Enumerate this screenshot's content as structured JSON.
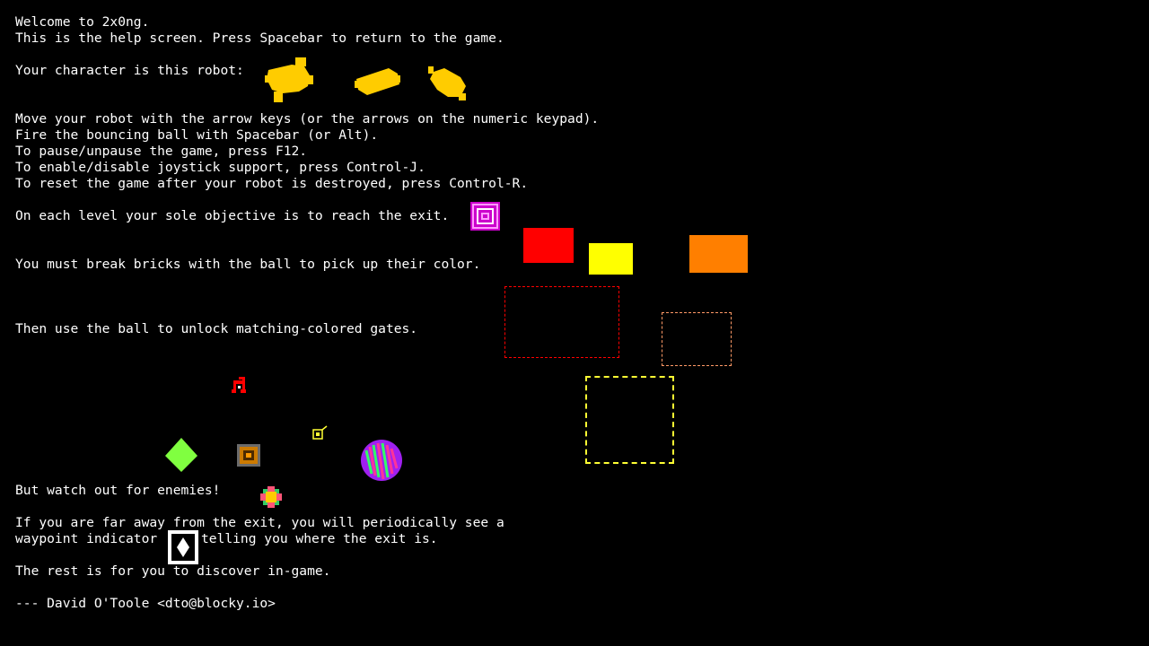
{
  "help": {
    "welcome": "Welcome to 2x0ng.",
    "help_screen": "This is the help screen. Press Spacebar to return to the game.",
    "character": "Your character is this robot:",
    "move": "Move your robot with the arrow keys (or the arrows on the numeric keypad).",
    "fire": "Fire the bouncing ball with Spacebar (or Alt).",
    "pause": "To pause/unpause the game, press F12.",
    "joystick": "To enable/disable joystick support, press Control-J.",
    "reset": "To reset the game after your robot is destroyed, press Control-R.",
    "objective": "On each level your sole objective is to reach the exit.",
    "bricks": "You must break bricks with the ball to pick up their color.",
    "gates": "Then use the ball to unlock matching-colored gates.",
    "enemies": "But watch out for enemies!",
    "waypoint_1": "If you are far away from the exit, you will periodically see a",
    "waypoint_2a": "waypoint indicator",
    "waypoint_2b": "telling you where the exit is.",
    "rest": "The rest is for you to discover in-game.",
    "credit": "--- David O'Toole <dto@blocky.io>"
  },
  "colors": {
    "background": "#000000",
    "text": "#ffffff",
    "robot": "#ffcc00",
    "exit": "#cc00cc",
    "brick_red": "#ff0000",
    "brick_yellow": "#ffff00",
    "brick_orange": "#ff7f00",
    "enemy_green": "#80ff40",
    "enemy_purple": "#a020f0"
  },
  "icons": {
    "robot": "robot-sprite",
    "exit": "exit-portal-icon",
    "waypoint": "waypoint-indicator-icon"
  }
}
